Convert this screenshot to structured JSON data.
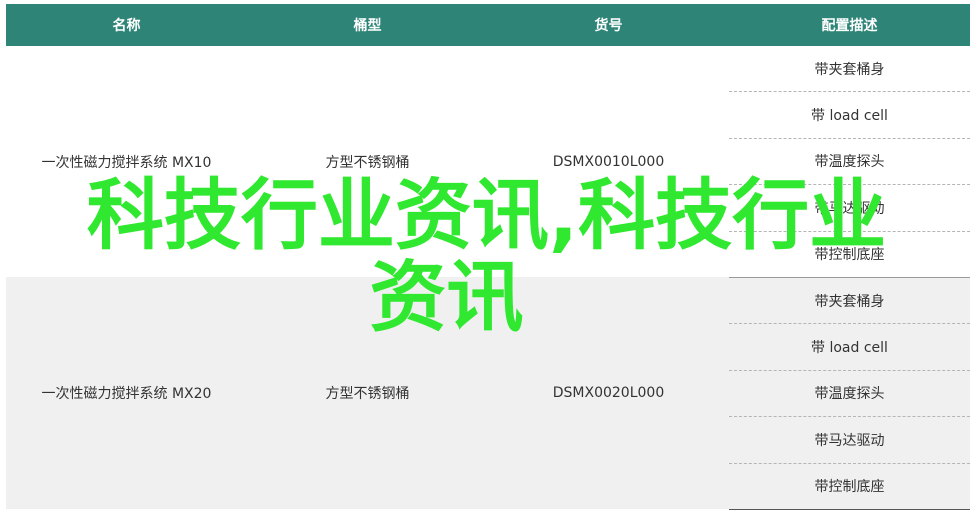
{
  "table": {
    "headers": [
      "名称",
      "桶型",
      "货号",
      "配置描述"
    ],
    "groups": [
      {
        "name": "一次性磁力搅拌系统 MX10",
        "barrel": "方型不锈钢桶",
        "sku": "DSMX0010L000",
        "configs": [
          "带夹套桶身",
          "带 load cell",
          "带温度探头",
          "带马达驱动",
          "带控制底座"
        ]
      },
      {
        "name": "一次性磁力搅拌系统 MX20",
        "barrel": "方型不锈钢桶",
        "sku": "DSMX0020L000",
        "configs": [
          "带夹套桶身",
          "带 load cell",
          "带温度探头",
          "带马达驱动",
          "带控制底座"
        ]
      }
    ]
  },
  "overlay": {
    "line1": "科技行业资讯,科技行业",
    "line2": "资讯"
  },
  "colors": {
    "header_bg": "#2e8577",
    "overlay_text": "#2fe82f",
    "alt_row_bg": "#f0f0f0"
  }
}
